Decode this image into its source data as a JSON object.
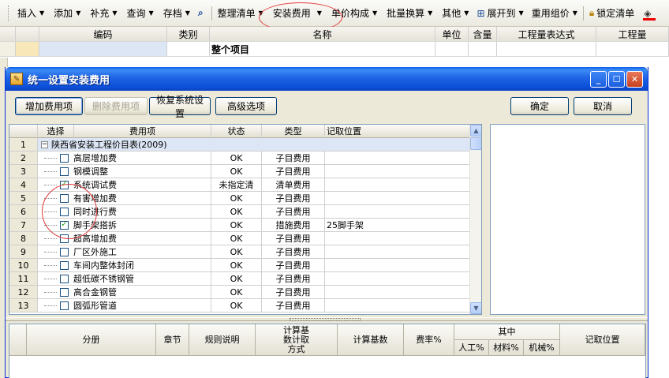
{
  "toolbar": {
    "items": [
      {
        "label": "插入",
        "arrow": true
      },
      {
        "label": "添加",
        "arrow": true
      },
      {
        "label": "补充",
        "arrow": true
      },
      {
        "label": "查询",
        "arrow": true
      },
      {
        "label": "存档",
        "arrow": true
      },
      {
        "label": "整理清单",
        "arrow": true
      },
      {
        "label": "安装费用",
        "arrow": true
      },
      {
        "label": "单价构成",
        "arrow": true
      },
      {
        "label": "批量换算",
        "arrow": true
      },
      {
        "label": "其他",
        "arrow": true
      },
      {
        "label": "展开到",
        "arrow": true
      },
      {
        "label": "重用组价",
        "arrow": true
      },
      {
        "label": "锁定清单",
        "arrow": false
      }
    ]
  },
  "sheet": {
    "headers": [
      "编码",
      "类别",
      "名称",
      "单位",
      "含量",
      "工程量表达式",
      "工程量"
    ],
    "row1_name": "整个项目"
  },
  "dialog": {
    "title": "统一设置安装费用",
    "buttons": {
      "add": "增加费用项",
      "delete": "删除费用项",
      "restore": "恢复系统设置",
      "advanced": "高级选项",
      "ok": "确定",
      "cancel": "取消"
    },
    "grid": {
      "headers": [
        "选择",
        "费用项",
        "状态",
        "类型",
        "记取位置"
      ],
      "group_row": {
        "num": "1",
        "label": "陕西省安装工程价目表(2009)"
      },
      "rows": [
        {
          "num": "2",
          "checked": false,
          "name": "高层增加费",
          "status": "OK",
          "type": "子目费用",
          "position": ""
        },
        {
          "num": "3",
          "checked": false,
          "name": "钢模调整",
          "status": "OK",
          "type": "子目费用",
          "position": ""
        },
        {
          "num": "4",
          "checked": true,
          "name": "系统调试费",
          "status": "未指定清",
          "type": "清单费用",
          "position": ""
        },
        {
          "num": "5",
          "checked": false,
          "name": "有害增加费",
          "status": "OK",
          "type": "子目费用",
          "position": ""
        },
        {
          "num": "6",
          "checked": false,
          "name": "同时进行费",
          "status": "OK",
          "type": "子目费用",
          "position": ""
        },
        {
          "num": "7",
          "checked": true,
          "name": "脚手架搭拆",
          "status": "OK",
          "type": "措施费用",
          "position": "25脚手架"
        },
        {
          "num": "8",
          "checked": false,
          "name": "超高增加费",
          "status": "OK",
          "type": "子目费用",
          "position": ""
        },
        {
          "num": "9",
          "checked": false,
          "name": "厂区外施工",
          "status": "OK",
          "type": "子目费用",
          "position": ""
        },
        {
          "num": "10",
          "checked": false,
          "name": "车间内整体封闭",
          "status": "OK",
          "type": "子目费用",
          "position": ""
        },
        {
          "num": "11",
          "checked": false,
          "name": "超低碳不锈钢管",
          "status": "OK",
          "type": "子目费用",
          "position": ""
        },
        {
          "num": "12",
          "checked": false,
          "name": "高合金钢管",
          "status": "OK",
          "type": "子目费用",
          "position": ""
        },
        {
          "num": "13",
          "checked": false,
          "name": "圆弧形管道",
          "status": "OK",
          "type": "子目费用",
          "position": ""
        }
      ]
    },
    "lower_grid": {
      "headers": {
        "fenc": "分册",
        "zhangjie": "章节",
        "guize": "规则说明",
        "jisuan_fangshi": "计算基数计取方式",
        "jisuan_jishu": "计算基数",
        "feilv": "费率%",
        "qizhong": "其中",
        "rengong": "人工%",
        "cailiao": "材料%",
        "jixie": "机械%",
        "jiqu": "记取位置"
      }
    }
  },
  "colors": {
    "title_blue": "#0c4fd8",
    "annotation_red": "#e23a3a",
    "check_green": "#21a121"
  }
}
